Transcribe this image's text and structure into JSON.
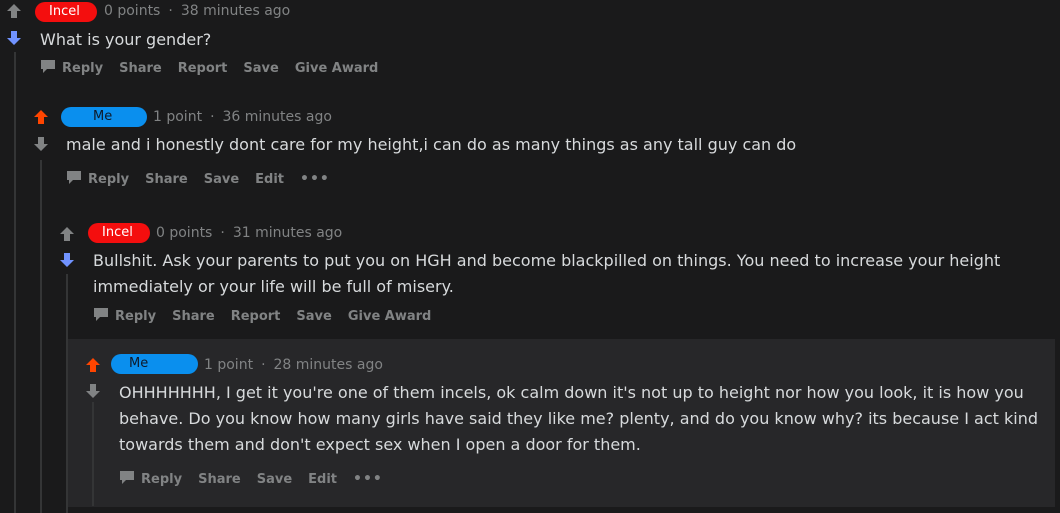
{
  "colors": {
    "background": "#1a1a1b",
    "highlight_background": "#272729",
    "thread_line": "#343536",
    "text": "#d7dadc",
    "meta": "#818384",
    "upvote_active": "#ff4500",
    "downvote_active": "#7193ff",
    "arrow_neutral": "#818384",
    "pill_red": "#f40e0e",
    "pill_blue": "#0a8fee"
  },
  "comments": [
    {
      "author": "Incel",
      "points": "0 points",
      "separator": "·",
      "time": "38 minutes ago",
      "vote_state": "down",
      "body": "What is your gender?",
      "actions": [
        "Reply",
        "Share",
        "Report",
        "Save",
        "Give Award"
      ]
    },
    {
      "author": "Me",
      "points": "1 point",
      "separator": "·",
      "time": "36 minutes ago",
      "vote_state": "up",
      "body": "male and i honestly dont care for my height,i can do as many things as any tall guy can do",
      "actions": [
        "Reply",
        "Share",
        "Save",
        "Edit",
        "•••"
      ]
    },
    {
      "author": "Incel",
      "points": "0 points",
      "separator": "·",
      "time": "31 minutes ago",
      "vote_state": "down",
      "body_lines": [
        "Bullshit. Ask your parents to put you on HGH and become blackpilled on things. You need to increase your height",
        "immediately or your life will be full of misery."
      ],
      "actions": [
        "Reply",
        "Share",
        "Report",
        "Save",
        "Give Award"
      ]
    },
    {
      "author": "Me",
      "points": "1 point",
      "separator": "·",
      "time": "28 minutes ago",
      "vote_state": "up",
      "body_lines": [
        "OHHHHHHH, I get it you're one of them incels, ok calm down it's not up to height nor how you look, it is how you",
        "behave. Do you know how many girls have said they like me? plenty, and do you know why? its because I act kind",
        "towards them and don't expect sex when I open a door for them."
      ],
      "actions": [
        "Reply",
        "Share",
        "Save",
        "Edit",
        "•••"
      ]
    }
  ]
}
